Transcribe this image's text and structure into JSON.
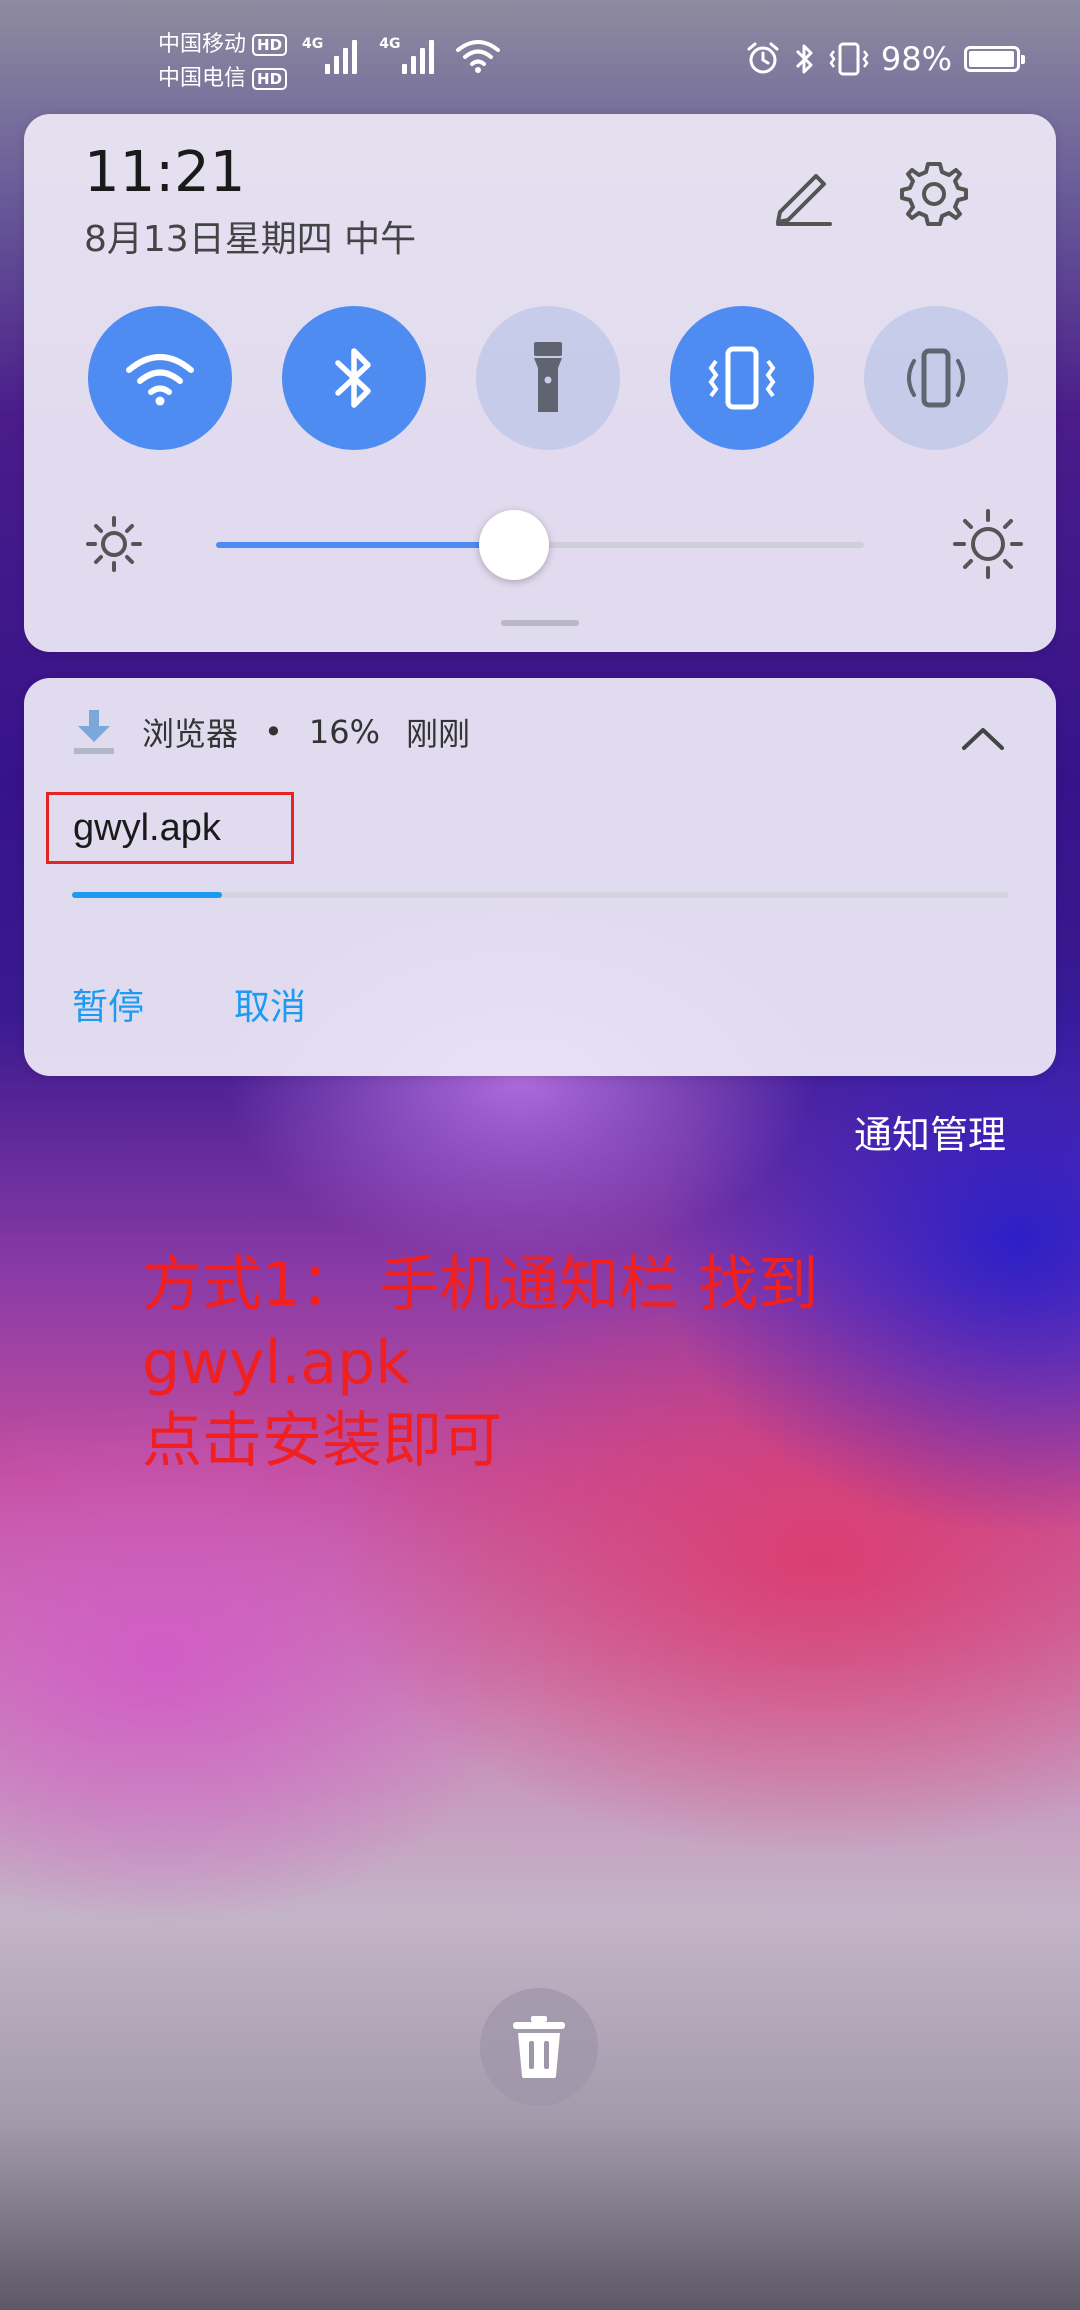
{
  "status_bar": {
    "carrier_1": "中国移动",
    "carrier_2": "中国电信",
    "hd_badge": "HD",
    "network_type": "4G",
    "battery_percent": "98%",
    "battery_level": 0.98
  },
  "quick_panel": {
    "time": "11:21",
    "date": "8月13日星期四 中午",
    "toggles": [
      {
        "name": "wifi",
        "state": "on"
      },
      {
        "name": "bluetooth",
        "state": "on"
      },
      {
        "name": "flashlight",
        "state": "off"
      },
      {
        "name": "vibrate",
        "state": "on"
      },
      {
        "name": "auto-rotate",
        "state": "off"
      }
    ],
    "brightness_level": 0.46
  },
  "notification": {
    "app_name": "浏览器",
    "separator": "•",
    "progress_text": "16%",
    "time": "刚刚",
    "file_name": "gwyl.apk",
    "progress": 0.16,
    "actions": {
      "pause": "暂停",
      "cancel": "取消"
    }
  },
  "notification_manage": "通知管理",
  "annotation": {
    "line1": "方式1： 手机通知栏 找到",
    "line2": "gwyl.apk",
    "line3": "点击安装即可"
  },
  "colors": {
    "accent": "#4f8cf2",
    "progress": "#1d9bf0",
    "annotation": "#f02020"
  }
}
